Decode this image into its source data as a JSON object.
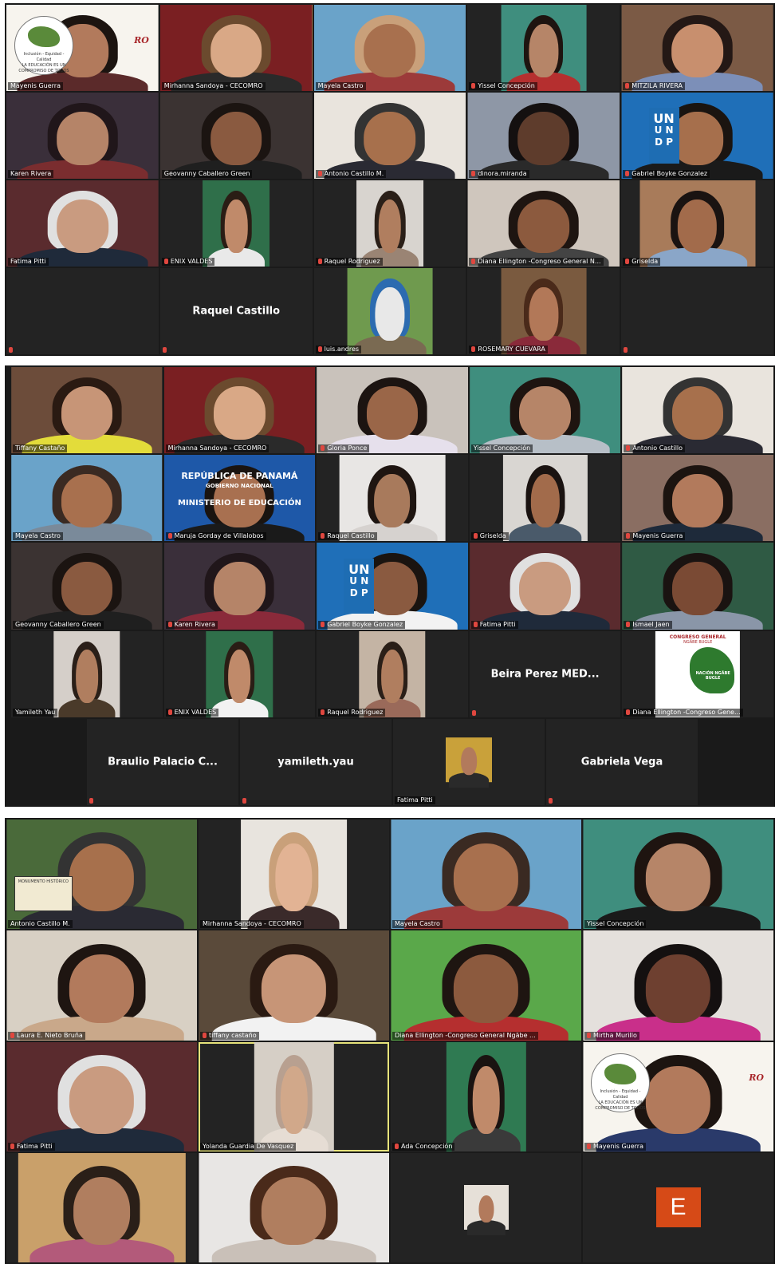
{
  "gallery1": [
    {
      "name": "Mayenis Guerra",
      "muted": false,
      "bg": "#f7f4ee",
      "skin": "#b27a5c",
      "hair": "#1c1410",
      "shirt": "#5b2a2a",
      "vw": 100,
      "extra": "logo"
    },
    {
      "name": "Mirhanna Sandoya - CECOMRO",
      "muted": false,
      "speaker": true,
      "bg": "#7a1f22",
      "skin": "#d9a886",
      "hair": "#6b4a2e",
      "shirt": "#2a2a2a",
      "vw": 100
    },
    {
      "name": "Mayela Castro",
      "muted": false,
      "bg": "#6aa3c9",
      "skin": "#a8704e",
      "hair": "#c9a07a",
      "shirt": "#9c3a3a",
      "vw": 100
    },
    {
      "name": "Yissel Concepción",
      "muted": true,
      "bg": "#3f8e7e",
      "skin": "#b68568",
      "hair": "#1e1410",
      "shirt": "#b52f2f",
      "vw": 56
    },
    {
      "name": "MITZILA RIVERA",
      "muted": true,
      "bg": "#7b5a45",
      "skin": "#c88f6e",
      "hair": "#241815",
      "shirt": "#7c8fb8",
      "vw": 100
    },
    {
      "name": "Karen Rivera",
      "muted": false,
      "bg": "#3a2f3a",
      "skin": "#b58468",
      "hair": "#20161a",
      "shirt": "#7a2d2f",
      "vw": 100
    },
    {
      "name": "Geovanny Caballero Green",
      "muted": false,
      "bg": "#3b3332",
      "skin": "#8a5a40",
      "hair": "#1b1411",
      "shirt": "#1f1f1f",
      "vw": 100
    },
    {
      "name": "Antonio Castillo M.",
      "muted": true,
      "bg": "#e9e4dd",
      "skin": "#a7704c",
      "hair": "#333",
      "shirt": "#2a2a33",
      "vw": 100
    },
    {
      "name": "dinora.miranda",
      "muted": true,
      "bg": "#8e97a6",
      "skin": "#5e3c2c",
      "hair": "#141010",
      "shirt": "#2a2a2a",
      "vw": 100
    },
    {
      "name": "Gabriel Boyke Gonzalez",
      "muted": true,
      "bg": "#1f6fb8",
      "skin": "#a66f4c",
      "hair": "#1a1410",
      "shirt": "#1a1a1a",
      "vw": 100,
      "extra": "undp"
    },
    {
      "name": "Fatima Pitti",
      "muted": false,
      "bg": "#5a2b2e",
      "skin": "#c99b80",
      "hair": "#e0e0e0",
      "shirt": "#1f2a3a",
      "vw": 100
    },
    {
      "name": "ENIX VALDES",
      "muted": true,
      "bg": "#2f6f4a",
      "skin": "#c08a6a",
      "hair": "#2a1d15",
      "shirt": "#e9e9e9",
      "vw": 44
    },
    {
      "name": "Raquel Rodriguez",
      "muted": true,
      "bg": "#d8d4cf",
      "skin": "#b07e5f",
      "hair": "#2a1f18",
      "shirt": "#9a8474",
      "vw": 44
    },
    {
      "name": "Diana Ellington -Congreso General  N...",
      "muted": true,
      "bg": "#cfc6bd",
      "skin": "#8c5a3e",
      "hair": "#1e1511",
      "shirt": "#444",
      "vw": 100
    },
    {
      "name": "Griselda",
      "muted": true,
      "bg": "#a87b5a",
      "skin": "#a26b4b",
      "hair": "#1a1311",
      "shirt": "#8aa6c8",
      "vw": 76
    },
    {
      "name": "",
      "muted": false,
      "empty": true
    },
    {
      "center": "Raquel Castillo",
      "muted": true
    },
    {
      "name": "luis.andres",
      "muted": true,
      "bg": "#6f9a4e",
      "skin": "#e8e8e8",
      "hair": "#2c6bb0",
      "shirt": "#7a6a52",
      "vw": 56
    },
    {
      "name": "ROSEMARY CUEVARA",
      "muted": true,
      "bg": "#7a5a3f",
      "skin": "#b27858",
      "hair": "#4a2a1a",
      "shirt": "#8a2a3a",
      "vw": 56
    },
    {
      "name": "",
      "muted": false,
      "empty": true
    }
  ],
  "gallery2": [
    {
      "name": "Tiffany Castaño",
      "muted": false,
      "bg": "#6c4c3a",
      "skin": "#c79577",
      "hair": "#2a1a12",
      "shirt": "#e3dc3a",
      "vw": 100
    },
    {
      "name": "Mirhanna Sandoya - CECOMRO",
      "muted": false,
      "speaker": true,
      "bg": "#7a1f22",
      "skin": "#d9a886",
      "hair": "#6b4a2e",
      "shirt": "#2a2a2a",
      "vw": 100
    },
    {
      "name": "Gloria Ponce",
      "muted": true,
      "bg": "#c9c2bb",
      "skin": "#9a6648",
      "hair": "#1c1411",
      "shirt": "#e6e0ec",
      "vw": 100
    },
    {
      "name": "Yissel Concepción",
      "muted": false,
      "bg": "#3f8e7e",
      "skin": "#b68568",
      "hair": "#1e1410",
      "shirt": "#b7bfc7",
      "vw": 100
    },
    {
      "name": "Antonio Castillo",
      "muted": true,
      "bg": "#e9e4dd",
      "skin": "#a7704c",
      "hair": "#333",
      "shirt": "#2a2a33",
      "vw": 100
    },
    {
      "name": "Mayela Castro",
      "muted": false,
      "bg": "#6aa3c9",
      "skin": "#a8704e",
      "hair": "#3a2a22",
      "shirt": "#7a8a9a",
      "vw": 100
    },
    {
      "name": "Maruja Gorday de Villalobos",
      "muted": true,
      "bg": "#1e58a8",
      "skin": "#a87050",
      "hair": "#1a1410",
      "shirt": "#1a1a1a",
      "vw": 100,
      "extra": "banner"
    },
    {
      "name": "Raquel Castillo",
      "muted": true,
      "bg": "#e8e6e4",
      "skin": "#a87a5c",
      "hair": "#1e1511",
      "shirt": "#d6d2cf",
      "vw": 70
    },
    {
      "name": "Griselda",
      "muted": true,
      "bg": "#d9d6d2",
      "skin": "#a26b4b",
      "hair": "#1a1311",
      "shirt": "#4a5a6a",
      "vw": 56
    },
    {
      "name": "Mayenis Guerra",
      "muted": true,
      "bg": "#8a6e62",
      "skin": "#b27a5c",
      "hair": "#1c1410",
      "shirt": "#1e2a3a",
      "vw": 100
    },
    {
      "name": "Geovanny Caballero Green",
      "muted": false,
      "bg": "#3b3332",
      "skin": "#8a5a40",
      "hair": "#1b1411",
      "shirt": "#1f1f1f",
      "vw": 100
    },
    {
      "name": "Karen Rivera",
      "muted": true,
      "bg": "#3a2f3a",
      "skin": "#b58468",
      "hair": "#20161a",
      "shirt": "#8a2a3a",
      "vw": 100
    },
    {
      "name": "Gabriel Boyke Gonzalez",
      "muted": true,
      "bg": "#1f6fb8",
      "skin": "#8a5a40",
      "hair": "#1a1410",
      "shirt": "#f2f2f2",
      "vw": 100,
      "extra": "undp"
    },
    {
      "name": "Fatima Pitti",
      "muted": true,
      "bg": "#5a2b2e",
      "skin": "#c99b80",
      "hair": "#e0e0e0",
      "shirt": "#1f2a3a",
      "vw": 100
    },
    {
      "name": "Ismael Jaen",
      "muted": true,
      "bg": "#2f5a44",
      "skin": "#7a4a34",
      "hair": "#1a1311",
      "shirt": "#8a96a8",
      "vw": 100
    },
    {
      "name": "Yamileth Yau",
      "muted": false,
      "bg": "#d5cfc9",
      "skin": "#b07e5f",
      "hair": "#2a1f18",
      "shirt": "#4a3a2a",
      "vw": 44
    },
    {
      "name": "ENIX VALDES",
      "muted": true,
      "bg": "#2f6f4a",
      "skin": "#c08a6a",
      "hair": "#2a1d15",
      "shirt": "#f2f2f2",
      "vw": 44
    },
    {
      "name": "Raquel Rodriguez",
      "muted": true,
      "bg": "#c4b4a4",
      "skin": "#b07e5f",
      "hair": "#2a1f18",
      "shirt": "#9a6a5a",
      "vw": 44
    },
    {
      "center": "Beira Perez MED...",
      "muted": true
    },
    {
      "name": "Diana Ellington -Congreso Gene...",
      "muted": true,
      "bg": "#ffffff",
      "vw": 56,
      "extra": "map"
    }
  ],
  "gallery2_last": [
    {
      "center": "Braulio Palacio C...",
      "muted": true
    },
    {
      "center": "yamileth.yau",
      "muted": true
    },
    {
      "name": "Fatima Pitti",
      "muted": false,
      "thumb": true
    },
    {
      "center": "Gabriela Vega",
      "muted": true
    }
  ],
  "gallery3": [
    {
      "name": "Antonio Castillo M.",
      "muted": false,
      "bg": "#4a6a3a",
      "skin": "#a7704c",
      "hair": "#333",
      "shirt": "#2a2a33",
      "vw": 100,
      "extra": "sign"
    },
    {
      "name": "Mirhanna Sandoya - CECOMRO",
      "muted": false,
      "bg": "#e8e4de",
      "skin": "#e2b394",
      "hair": "#c9a07a",
      "shirt": "#3a2a2a",
      "vw": 56
    },
    {
      "name": "Mayela Castro",
      "muted": false,
      "bg": "#6aa3c9",
      "skin": "#a8704e",
      "hair": "#3a2a22",
      "shirt": "#9c3a3a",
      "vw": 100
    },
    {
      "name": "Yissel Concepción",
      "muted": false,
      "bg": "#3f8e7e",
      "skin": "#b68568",
      "hair": "#1e1410",
      "shirt": "#1a1a1a",
      "vw": 100
    },
    {
      "name": "Laura E. Nieto Bruña",
      "muted": true,
      "bg": "#d8d0c4",
      "skin": "#b27a5c",
      "hair": "#1e1511",
      "shirt": "#c9a88a",
      "vw": 100
    },
    {
      "name": "tiffany castaño",
      "muted": true,
      "bg": "#5a4a3a",
      "skin": "#c79577",
      "hair": "#2a1a12",
      "shirt": "#f2f2f2",
      "vw": 100
    },
    {
      "name": "Diana Ellington -Congreso General  Ngäbe ...",
      "muted": false,
      "bg": "#5aa84a",
      "skin": "#8c5a3e",
      "hair": "#1e1511",
      "shirt": "#b52f2f",
      "vw": 100
    },
    {
      "name": "Mirtha Murillo",
      "muted": true,
      "bg": "#e4e0dc",
      "skin": "#6e4030",
      "hair": "#141010",
      "shirt": "#c92f8a",
      "vw": 100
    },
    {
      "name": "Fatima Pitti",
      "muted": true,
      "bg": "#5a2b2e",
      "skin": "#c99b80",
      "hair": "#e0e0e0",
      "shirt": "#1f2a3a",
      "vw": 100
    },
    {
      "name": "Yolanda Guardia De Vasquez",
      "muted": false,
      "speaker": true,
      "bg": "#d6cfc6",
      "skin": "#d1a88a",
      "hair": "#b8a090",
      "shirt": "#e6ddd4",
      "vw": 42
    },
    {
      "name": "Ada Concepción",
      "muted": true,
      "bg": "#2f7a52",
      "skin": "#c08a6a",
      "hair": "#1a1311",
      "shirt": "#3a3a3a",
      "vw": 42
    },
    {
      "name": "Mayenis Guerra",
      "muted": true,
      "bg": "#f7f4ee",
      "skin": "#b27a5c",
      "hair": "#1c1410",
      "shirt": "#2a3a6a",
      "vw": 100,
      "extra": "logo"
    },
    {
      "name": "",
      "muted": false,
      "bg": "#c9a06a",
      "skin": "#b07e5f",
      "hair": "#2a1f18",
      "shirt": "#b35a7a",
      "vw": 88
    },
    {
      "name": "",
      "muted": false,
      "bg": "#e8e6e4",
      "skin": "#b07e5f",
      "hair": "#4a2a1a",
      "shirt": "#c9c0b8",
      "vw": 100
    },
    {
      "name": "",
      "muted": false,
      "thumb2": true
    },
    {
      "name": "",
      "muted": false,
      "avatar": "E"
    }
  ],
  "logo": {
    "text1": "Inclusión - Equidad - Calidad",
    "text2": "LA EDUCACIÓN ES UN COMPROMISO DE TODOS",
    "brand": "RO"
  },
  "undp": {
    "top": "UN",
    "line1": "U N",
    "line2": "D P"
  },
  "banner": {
    "l1": "REPÚBLICA DE PANAMÁ",
    "l2": "GOBIERNO NACIONAL",
    "l3": "MINISTERIO DE EDUCACIÓN"
  },
  "map": {
    "title": "CONGRESO GENERAL",
    "sub": "NGÄBE BUGLE",
    "nation": "NACIÓN NGÄBE BUGLE"
  },
  "sign": {
    "text": "MONUMENTO HISTÓRICO"
  }
}
